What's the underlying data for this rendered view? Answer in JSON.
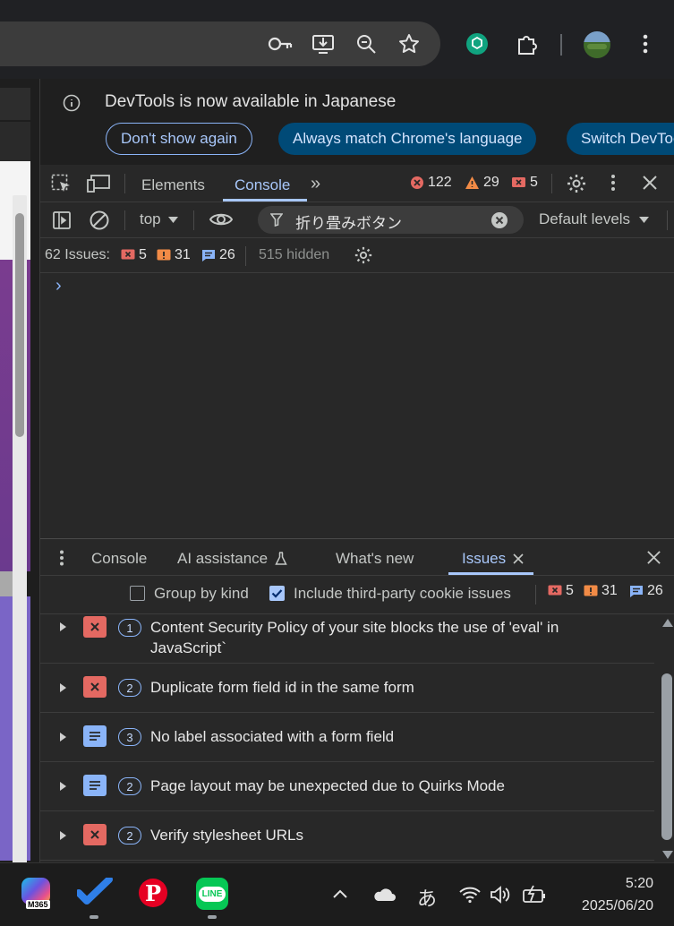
{
  "browser": {
    "icons": [
      "key-icon",
      "install-icon",
      "zoom-icon",
      "bookmark-star-icon",
      "chatgpt-extension-icon",
      "extensions-icon",
      "profile-avatar",
      "menu-icon"
    ]
  },
  "infobar": {
    "message": "DevTools is now available in Japanese",
    "buttons": {
      "dont_show": "Don't show again",
      "always_match": "Always match Chrome's language",
      "switch": "Switch DevTools to Japanese"
    }
  },
  "devtools": {
    "tabs": {
      "elements": "Elements",
      "console": "Console"
    },
    "counts": {
      "errors": "122",
      "warnings": "29",
      "issues": "5"
    },
    "console_toolbar": {
      "context": "top",
      "filter_value": "折り畳みボタン",
      "levels": "Default levels"
    },
    "issues_line": {
      "label": "62 Issues:",
      "errors": "5",
      "warnings": "31",
      "info": "26",
      "hidden": "515 hidden"
    },
    "prompt": "›",
    "drawer": {
      "tabs": {
        "console": "Console",
        "ai": "AI assistance",
        "whats_new": "What's new",
        "issues": "Issues"
      },
      "group_by_kind": "Group by kind",
      "include_third_party": "Include third-party cookie issues",
      "counts": {
        "errors": "5",
        "warnings": "31",
        "info": "26"
      },
      "issues": [
        {
          "kind": "error",
          "count": "1",
          "title": "Content Security Policy of your site blocks the use of 'eval' in JavaScript`"
        },
        {
          "kind": "error",
          "count": "2",
          "title": "Duplicate form field id in the same form"
        },
        {
          "kind": "info",
          "count": "3",
          "title": "No label associated with a form field"
        },
        {
          "kind": "info",
          "count": "2",
          "title": "Page layout may be unexpected due to Quirks Mode"
        },
        {
          "kind": "error",
          "count": "2",
          "title": "Verify stylesheet URLs"
        }
      ]
    }
  },
  "taskbar": {
    "m365_label": "M365",
    "line_label": "LINE",
    "ime": "あ",
    "time": "5:20",
    "date": "2025/06/20"
  },
  "colors": {
    "error": "#e46962",
    "warning": "#f28b46",
    "info": "#8ab4f8",
    "accent": "#a8c7fa",
    "button_primary": "#004a77"
  }
}
